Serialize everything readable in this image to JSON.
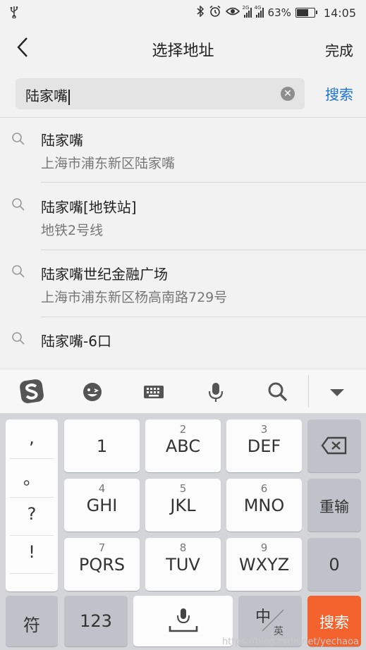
{
  "status": {
    "usb_icon": "usb-icon",
    "battery": "63%",
    "time": "14:05",
    "net1": "2G",
    "net2": "4G"
  },
  "header": {
    "title": "选择地址",
    "done": "完成"
  },
  "search": {
    "value": "陆家嘴",
    "button": "搜索"
  },
  "results": [
    {
      "name": "陆家嘴",
      "address": "上海市浦东新区陆家嘴"
    },
    {
      "name": "陆家嘴[地铁站]",
      "address": "地铁2号线"
    },
    {
      "name": "陆家嘴世纪金融广场",
      "address": "上海市浦东新区杨高南路729号"
    },
    {
      "name": "陆家嘴-6口",
      "address": ""
    }
  ],
  "keyboard": {
    "punct": [
      ",",
      "。",
      "?",
      "!"
    ],
    "row1": [
      {
        "sub": "",
        "main": "1"
      },
      {
        "sub": "2",
        "main": "ABC"
      },
      {
        "sub": "3",
        "main": "DEF"
      }
    ],
    "row2": [
      {
        "sub": "4",
        "main": "GHI"
      },
      {
        "sub": "5",
        "main": "JKL"
      },
      {
        "sub": "6",
        "main": "MNO"
      }
    ],
    "row3": [
      {
        "sub": "7",
        "main": "PQRS"
      },
      {
        "sub": "8",
        "main": "TUV"
      },
      {
        "sub": "9",
        "main": "WXYZ"
      }
    ],
    "reinput": "重输",
    "zero": "0",
    "symbol": "符",
    "num123": "123",
    "lang_main": "中",
    "lang_sub": "英",
    "search": "搜索"
  },
  "watermark": "https://blog.csdn.net/yechaoa",
  "colors": {
    "accent": "#1e73d8",
    "search_key": "#f4622d"
  }
}
